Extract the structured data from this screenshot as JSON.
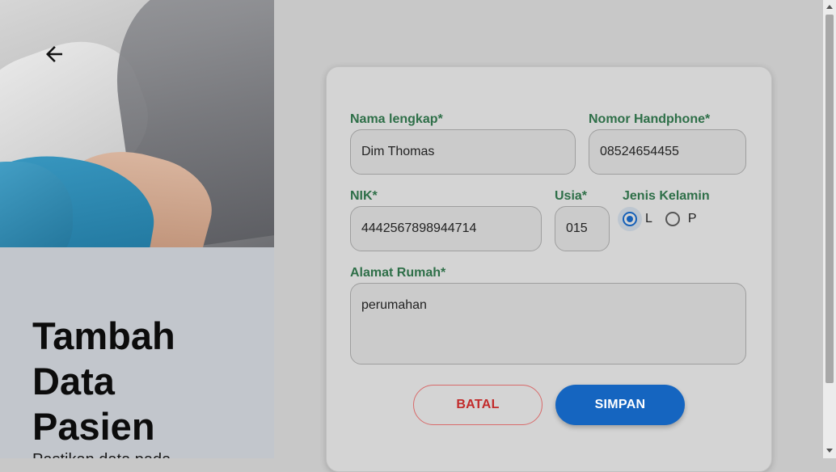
{
  "left_panel": {
    "title_line1": "Tambah",
    "title_line2": "Data",
    "title_line3": "Pasien",
    "subtitle": "Pastikan data pada"
  },
  "form": {
    "name_label": "Nama lengkap*",
    "name_value": "Dim Thomas",
    "phone_label": "Nomor Handphone*",
    "phone_value": "08524654455",
    "nik_label": "NIK*",
    "nik_value": "4442567898944714",
    "age_label": "Usia*",
    "age_value": "015",
    "gender_label": "Jenis Kelamin",
    "gender_options": [
      "L",
      "P"
    ],
    "gender_selected": "L",
    "address_label": "Alamat Rumah*",
    "address_value": "perumahan"
  },
  "buttons": {
    "cancel_label": "BATAL",
    "save_label": "SIMPAN"
  },
  "icons": {
    "back": "arrow-left-icon"
  },
  "colors": {
    "label_green": "#2e6f48",
    "primary_blue": "#1565c0",
    "cancel_red": "#c22b2b"
  }
}
